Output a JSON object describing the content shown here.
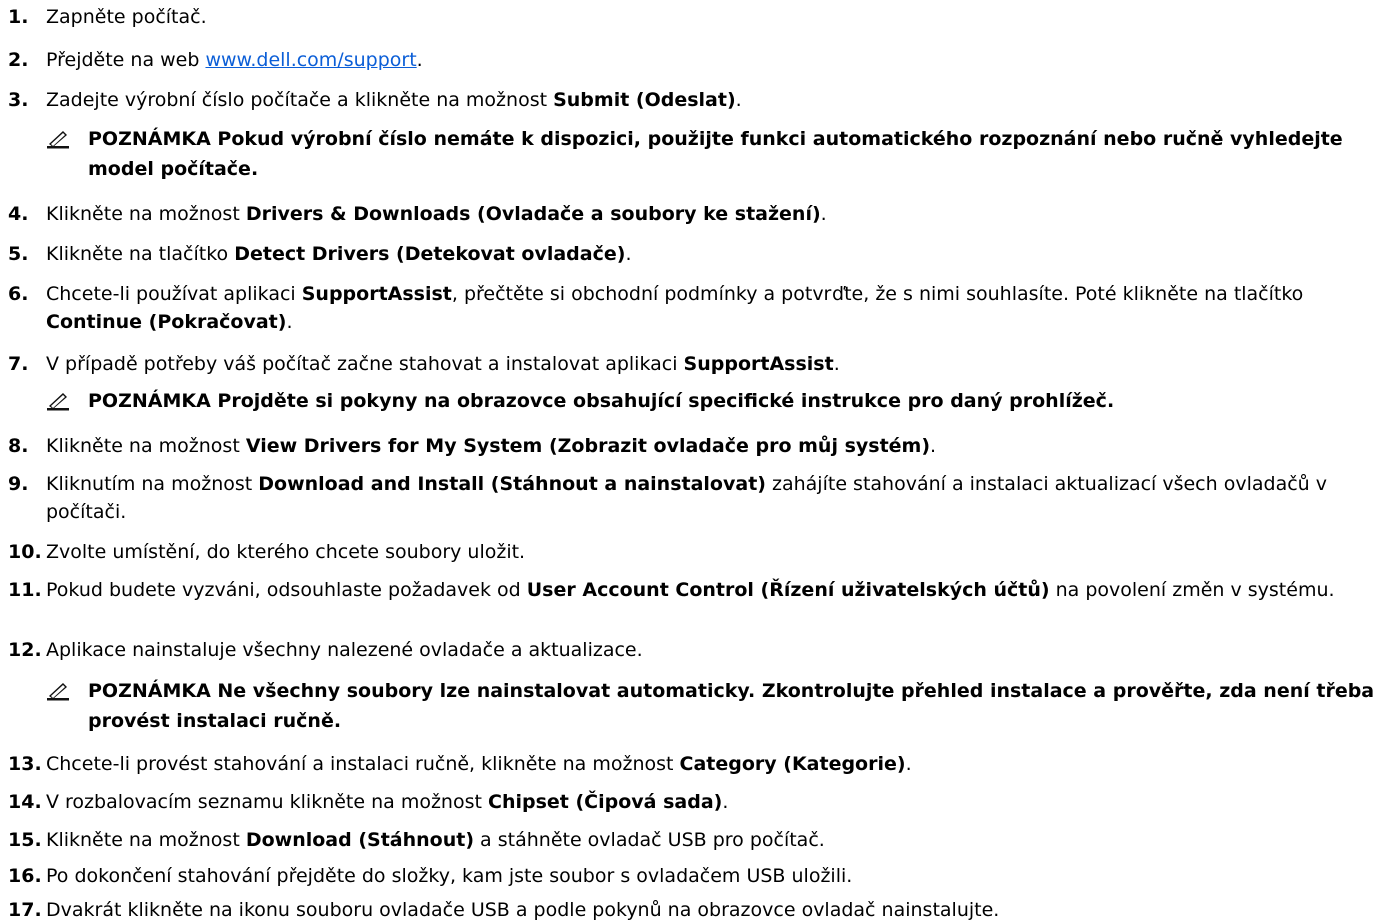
{
  "steps": [
    {
      "num": "1.",
      "parts": [
        "Zapněte počítač."
      ]
    },
    {
      "num": "2.",
      "pre": "Přejděte na web ",
      "link": "www.dell.com/support",
      "post": "."
    },
    {
      "num": "3.",
      "pre": "Zadejte výrobní číslo počítače a klikněte na možnost ",
      "bold": "Submit (Odeslat)",
      "post": "."
    },
    {
      "num": "4.",
      "pre": "Klikněte na možnost ",
      "bold": "Drivers & Downloads (Ovladače a soubory ke stažení)",
      "post": "."
    },
    {
      "num": "5.",
      "pre": "Klikněte na tlačítko ",
      "bold": "Detect Drivers (Detekovat ovladače)",
      "post": "."
    },
    {
      "num": "6.",
      "pre": "Chcete-li používat aplikaci ",
      "bold": "SupportAssist",
      "mid": ", přečtěte si obchodní podmínky a potvrďte, že s nimi souhlasíte. Poté klikněte na tlačítko ",
      "bold2": "Continue (Pokračovat)",
      "post": "."
    },
    {
      "num": "7.",
      "pre": "V případě potřeby váš počítač začne stahovat a instalovat aplikaci ",
      "bold": "SupportAssist",
      "post": "."
    },
    {
      "num": "8.",
      "pre": "Klikněte na možnost ",
      "bold": "View Drivers for My System (Zobrazit ovladače pro můj systém)",
      "post": "."
    },
    {
      "num": "9.",
      "pre": "Kliknutím na možnost ",
      "bold": "Download and Install (Stáhnout a nainstalovat)",
      "post": " zahájíte stahování a instalaci aktualizací všech ovladačů v počítači."
    },
    {
      "num": "10.",
      "pre": "Zvolte umístění, do kterého chcete soubory uložit."
    },
    {
      "num": "11.",
      "pre": "Pokud budete vyzváni, odsouhlaste požadavek od ",
      "bold": "User Account Control (Řízení uživatelských účtů)",
      "post": " na povolení změn v systému."
    },
    {
      "num": "12.",
      "pre": "Aplikace nainstaluje všechny nalezené ovladače a aktualizace."
    },
    {
      "num": "13.",
      "pre": "Chcete-li provést stahování a instalaci ručně, klikněte na možnost ",
      "bold": "Category (Kategorie)",
      "post": "."
    },
    {
      "num": "14.",
      "pre": "V rozbalovacím seznamu klikněte na možnost ",
      "bold": "Chipset (Čipová sada)",
      "post": "."
    },
    {
      "num": "15.",
      "pre": "Klikněte na možnost ",
      "bold": "Download (Stáhnout)",
      "post": " a stáhněte ovladač USB pro počítač."
    },
    {
      "num": "16.",
      "pre": "Po dokončení stahování přejděte do složky, kam jste soubor s ovladačem USB uložili."
    },
    {
      "num": "17.",
      "pre": "Dvakrát klikněte na ikonu souboru ovladače USB a podle pokynů na obrazovce ovladač nainstalujte."
    }
  ],
  "notes": [
    "POZNÁMKA Pokud výrobní číslo nemáte k dispozici, použijte funkci automatického rozpoznání nebo ručně vyhledejte model počítače.",
    "POZNÁMKA Projděte si pokyny na obrazovce obsahující specifické instrukce pro daný prohlížeč.",
    "POZNÁMKA Ne všechny soubory lze nainstalovat automaticky. Zkontrolujte přehled instalace a prověřte, zda není třeba provést instalaci ručně."
  ],
  "colors": {
    "link": "#0b5ed7",
    "text": "#000000",
    "background": "#ffffff"
  }
}
